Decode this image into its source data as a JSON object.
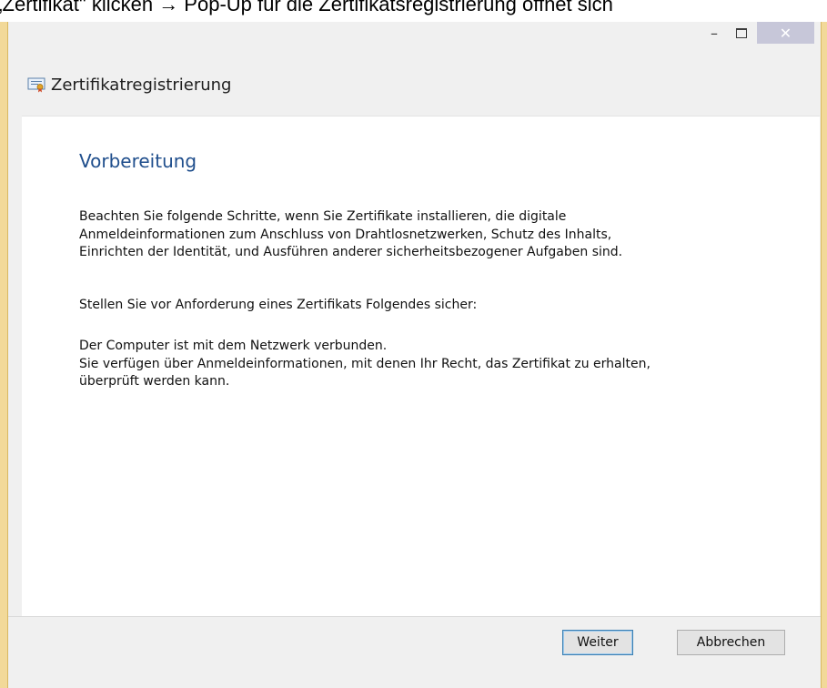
{
  "caption": "ie „Zertifikat\" klicken → Pop-Up für die Zertifikatsregistrierung öffnet sich",
  "window": {
    "title": "Zertifikatregistrierung",
    "controls": {
      "minimize": "–",
      "maximize_icon": "maximize-icon",
      "close": "✕"
    }
  },
  "content": {
    "heading": "Vorbereitung",
    "paragraph1_lines": [
      "Beachten Sie folgende Schritte, wenn Sie Zertifikate installieren, die digitale",
      "Anmeldeinformationen zum Anschluss von Drahtlosnetzwerken, Schutz des Inhalts,",
      "Einrichten der Identität, und Ausführen anderer sicherheitsbezogener Aufgaben sind."
    ],
    "paragraph2": "Stellen Sie vor Anforderung eines Zertifikats Folgendes sicher:",
    "paragraph3_lines": [
      "Der Computer ist mit dem Netzwerk verbunden.",
      "Sie verfügen über Anmeldeinformationen, mit denen Ihr Recht, das Zertifikat zu erhalten,",
      "überprüft werden kann."
    ]
  },
  "footer": {
    "next_label": "Weiter",
    "cancel_label": "Abbrechen"
  },
  "colors": {
    "heading": "#1f4e8c",
    "close_button": "#c7c7d9",
    "window_frame": "#f2d999"
  }
}
